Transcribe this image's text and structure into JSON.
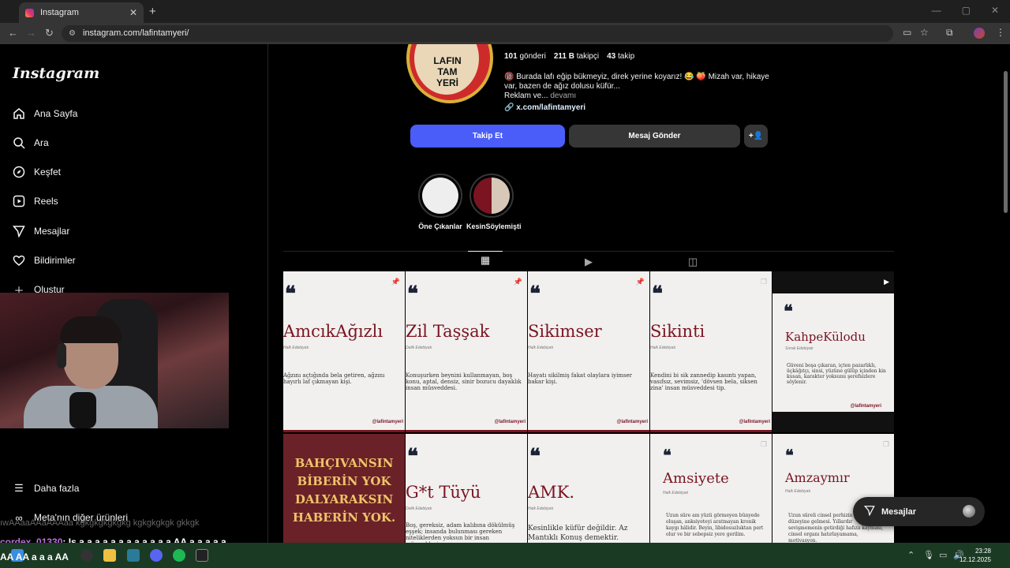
{
  "browser": {
    "tab_title": "Instagram",
    "tab_close": "✕",
    "new_tab": "+",
    "url": "instagram.com/lafintamyeri/",
    "back": "←",
    "forward": "→",
    "reload": "↻"
  },
  "sidebar": {
    "logo": "Instagram",
    "items": [
      {
        "label": "Ana Sayfa",
        "icon": "home-icon"
      },
      {
        "label": "Ara",
        "icon": "search-icon"
      },
      {
        "label": "Keşfet",
        "icon": "compass-icon"
      },
      {
        "label": "Reels",
        "icon": "reels-icon"
      },
      {
        "label": "Mesajlar",
        "icon": "send-icon"
      },
      {
        "label": "Bildirimler",
        "icon": "heart-icon"
      },
      {
        "label": "Oluştur",
        "icon": "plus-icon"
      }
    ],
    "more": "Daha fazla",
    "meta": "Meta'nın diğer ürünleri"
  },
  "profile": {
    "logo_text": "LAFIN TAM YERİ",
    "posts_count": "101",
    "posts_label": "gönderi",
    "followers_count": "211 B",
    "followers_label": "takipçi",
    "following_count": "43",
    "following_label": "takip",
    "bio_line1": "🔞 Burada lafı eğip bükmeyiz, direk yerine koyarız! 😂 🍑 Mizah var, hikaye var, bazen de ağız dolusu küfür...",
    "bio_line2": "Reklam ve...",
    "bio_more": "devamı",
    "link": "x.com/lafintamyeri",
    "follow_button": "Takip Et",
    "message_button": "Mesaj Gönder",
    "add_user_icon": "+👤"
  },
  "highlights": [
    {
      "label": "Öne Çıkanlar"
    },
    {
      "label": "KesinSöylemişti"
    }
  ],
  "posts": [
    {
      "title": "AmcıkAğızlı",
      "sub": "Halk Edebiyatı",
      "def": "Ağzını açtığında bela getiren, ağzını hayırlı laf çıkmayan kişi.",
      "handle": "@lafintamyeri"
    },
    {
      "title": "Zil Taşşak",
      "sub": "Delik Edebiyatı",
      "def": "Konuşurken beynini kullanmayan, boş konu, aptal, densiz, sinir bozucu dayaklık insan müsveddesi.",
      "handle": "@lafintamyeri"
    },
    {
      "title": "Sikimser",
      "sub": "Halk Edebiyatı",
      "def": "Hayatı sikilmiş fakat olaylara iyimser bakar kişi.",
      "handle": "@lafintamyeri"
    },
    {
      "title": "Sikinti",
      "sub": "Halk Edebiyatı",
      "def": "Kendini bi sik zannedip kasıntı yapan, vasıfsız, sevimsiz, 'dövsen bela, siksen zina' insan müsveddesi tip.",
      "handle": "@lafintamyeri"
    },
    {
      "title": "KahpeKülodu",
      "sub": "Sırrak Edebiyatı",
      "def": "Güveni boşa çıkaran, içten pazarlıklı, üçkâğıtçı, sinsi, yüzüne gülüp içinden kin kusan, karakter yoksunu şerefsizlere söylenir.",
      "handle": "@lafintamyeri"
    },
    {
      "title": "BAHÇIVANSIN BİBERİN YOK DALYARAKSIN HABERİN YOK.",
      "sub": "",
      "def": "",
      "handle": ""
    },
    {
      "title": "G*t Tüyü",
      "sub": "Delik Edebiyatı",
      "def": "Boş, gereksiz, adam kalıbına dökülmüş eşşek; insanda bulunması gereken niteliklerden yoksun bir insan müsveddesi.",
      "handle": ""
    },
    {
      "title": "AMK.",
      "sub": "Halk Edebiyatı",
      "def": "Kesinlikle küfür değildir. Az Mantıklı Konuş demektir.",
      "handle": ""
    },
    {
      "title": "Amsiyete",
      "sub": "Halk Edebiyatı",
      "def": "Uzun süre am yüzü görmeyen bünyede oluşan, anksiyeteyi aratmayan kronik kaygı hâlidir. Beyin, libidosuzluktan pert olur ve bir sebepsiz yere gerilim.",
      "handle": ""
    },
    {
      "title": "Amzaymır",
      "sub": "Halk Edebiyatı",
      "def": "Uzun süreli cinsel perhizin 'amı unutma' düzeyine gelmesi. Yıllardır sevişmemenin getirdiği hafıza kayması, cinsel organı hatırlayamama, motivasyon.",
      "handle": ""
    }
  ],
  "messages_button": "Mesajlar",
  "stream_chat": {
    "line1": "ıwAAaaAAaAAAaa kgkgkgkgkgkg kgkgkgkgk gkkgk",
    "user": "cordex_01330",
    "message": ": Is a a a a a a a a a a a a AA a a a a a",
    "line3": "AA AA a a a AA"
  },
  "taskbar": {
    "time": "23:28",
    "date": "12.12.2025"
  },
  "colors": {
    "follow_blue": "#4a5df9",
    "button_gray": "#363636",
    "brand_red": "#7a1420"
  }
}
